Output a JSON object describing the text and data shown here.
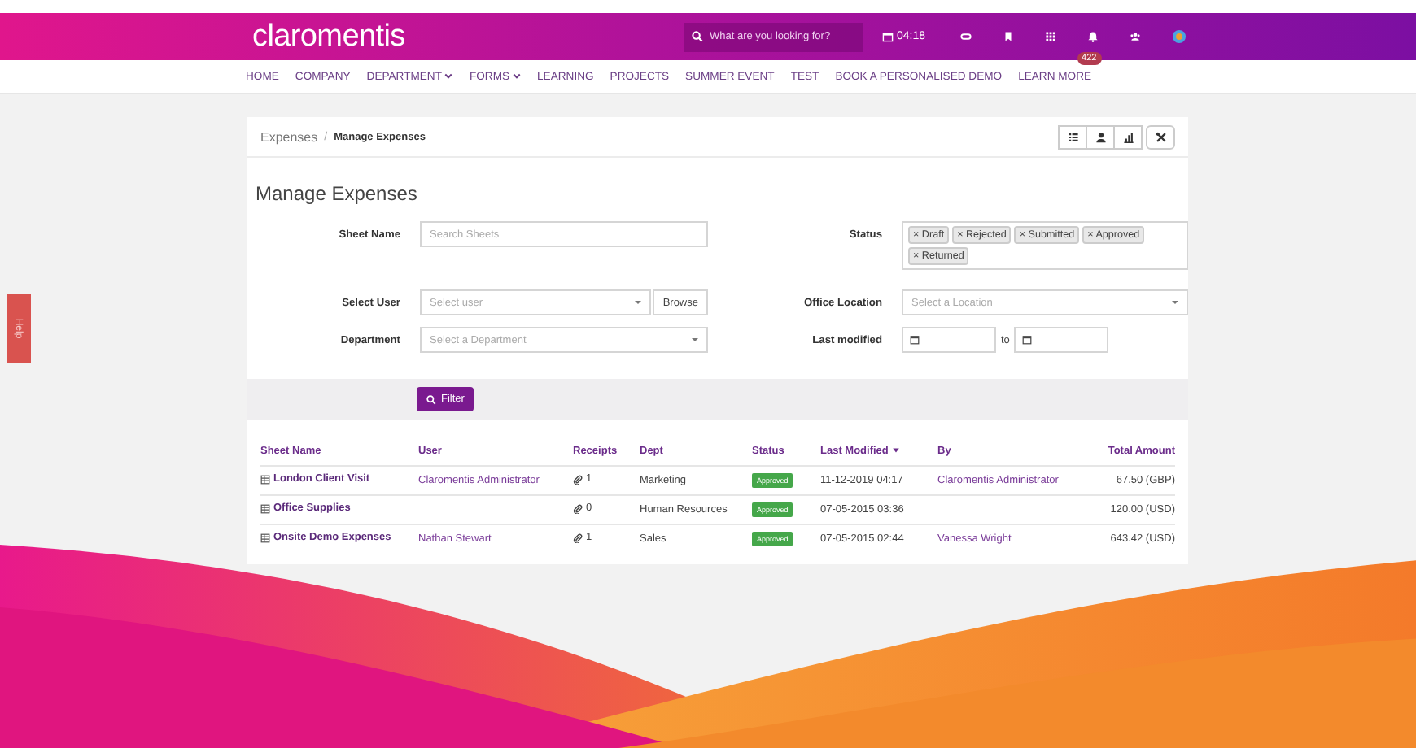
{
  "header": {
    "logo": "claromentis",
    "search": {
      "placeholder": "What are you looking for?"
    },
    "time": "04:18",
    "notification_count": "422"
  },
  "nav": [
    {
      "label": "HOME",
      "dropdown": false
    },
    {
      "label": "COMPANY",
      "dropdown": false
    },
    {
      "label": "DEPARTMENT",
      "dropdown": true
    },
    {
      "label": "FORMS",
      "dropdown": true
    },
    {
      "label": "LEARNING",
      "dropdown": false
    },
    {
      "label": "PROJECTS",
      "dropdown": false
    },
    {
      "label": "SUMMER EVENT",
      "dropdown": false
    },
    {
      "label": "TEST",
      "dropdown": false
    },
    {
      "label": "BOOK A PERSONALISED DEMO",
      "dropdown": false
    },
    {
      "label": "LEARN MORE",
      "dropdown": false
    }
  ],
  "help_tab": "Help",
  "breadcrumb": {
    "items": [
      "Expenses",
      "Manage Expenses"
    ],
    "separator": "/"
  },
  "title": "Manage Expenses",
  "form": {
    "sheet_name": {
      "label": "Sheet Name",
      "placeholder": "Search Sheets"
    },
    "status": {
      "label": "Status",
      "tags": [
        {
          "remove": "×",
          "label": "Draft"
        },
        {
          "remove": "×",
          "label": "Rejected"
        },
        {
          "remove": "×",
          "label": "Submitted"
        },
        {
          "remove": "×",
          "label": "Approved"
        },
        {
          "remove": "×",
          "label": "Returned"
        }
      ]
    },
    "select_user": {
      "label": "Select User",
      "placeholder": "Select user",
      "button": "Browse"
    },
    "office_location": {
      "label": "Office Location",
      "placeholder": "Select a Location"
    },
    "department": {
      "label": "Department",
      "placeholder": "Select a Department"
    },
    "last_modified": {
      "label": "Last modified",
      "separator": "to"
    },
    "filter_button": "Filter"
  },
  "table": {
    "columns": [
      {
        "label": "Sheet Name",
        "sorted": false
      },
      {
        "label": "User",
        "sorted": false
      },
      {
        "label": "Receipts",
        "sorted": false
      },
      {
        "label": "Dept",
        "sorted": false
      },
      {
        "label": "Status",
        "sorted": false
      },
      {
        "label": "Last Modified",
        "sorted": true
      },
      {
        "label": "By",
        "sorted": false
      },
      {
        "label": "Total Amount",
        "sorted": false
      }
    ],
    "rows": [
      {
        "sheet_name": "London Client Visit",
        "user": "Claromentis Administrator",
        "receipts": "1",
        "dept": "Marketing",
        "status": "Approved",
        "last_modified": "11-12-2019 04:17",
        "by": "Claromentis Administrator",
        "total": "67.50 (GBP)"
      },
      {
        "sheet_name": "Office Supplies",
        "receipts": "0",
        "dept": "Human Resources",
        "status": "Approved",
        "last_modified": "07-05-2015 03:36",
        "total": "120.00 (USD)"
      },
      {
        "sheet_name": "Onsite Demo Expenses",
        "user": "Nathan Stewart",
        "receipts": "1",
        "dept": "Sales",
        "status": "Approved",
        "last_modified": "07-05-2015 02:44",
        "by": "Vanessa Wright",
        "total": "643.42 (USD)"
      }
    ]
  }
}
